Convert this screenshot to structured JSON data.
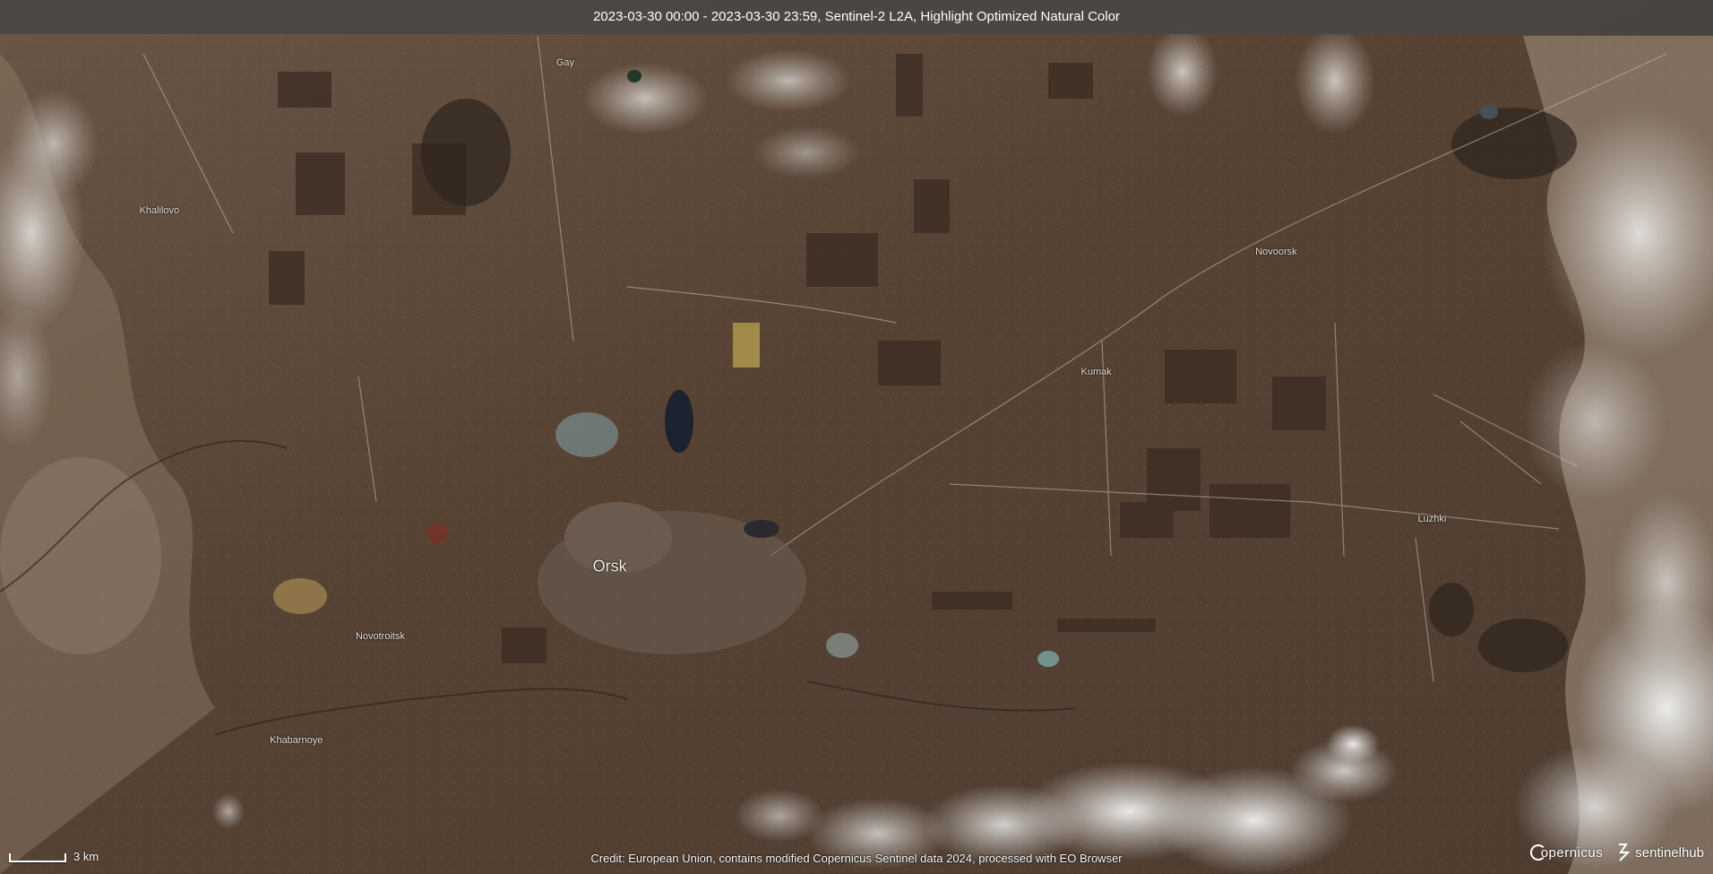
{
  "header": {
    "title": "2023-03-30 00:00 - 2023-03-30 23:59, Sentinel-2 L2A, Highlight Optimized Natural Color"
  },
  "places": [
    {
      "name": "Gay",
      "lon_frac": 0.33,
      "lat_frac": 0.072,
      "size": "small"
    },
    {
      "name": "Khalilovo",
      "lon_frac": 0.093,
      "lat_frac": 0.241,
      "size": "small"
    },
    {
      "name": "Novoorsk",
      "lon_frac": 0.745,
      "lat_frac": 0.288,
      "size": "small"
    },
    {
      "name": "Kumak",
      "lon_frac": 0.64,
      "lat_frac": 0.426,
      "size": "small"
    },
    {
      "name": "Luzhki",
      "lon_frac": 0.836,
      "lat_frac": 0.594,
      "size": "small"
    },
    {
      "name": "Orsk",
      "lon_frac": 0.356,
      "lat_frac": 0.648,
      "size": "large"
    },
    {
      "name": "Novotroitsk",
      "lon_frac": 0.222,
      "lat_frac": 0.728,
      "size": "small"
    },
    {
      "name": "Khabarnoye",
      "lon_frac": 0.173,
      "lat_frac": 0.847,
      "size": "small"
    }
  ],
  "scale": {
    "label": "3 km"
  },
  "footer": {
    "credit": "Credit: European Union, contains modified Copernicus Sentinel data 2024, processed with EO Browser"
  },
  "logos": {
    "copernicus_icon": "copernicus-logo-icon",
    "copernicus": "opernicus",
    "sentinelhub_icon": "sentinelhub-logo-icon",
    "sentinelhub": "sentinelhub"
  },
  "colors": {
    "land": "#5a4636",
    "dark_fields": "#3a2c22",
    "snow": "#e8e6e2",
    "water": "#1c2230",
    "title_bar": "#464646"
  }
}
